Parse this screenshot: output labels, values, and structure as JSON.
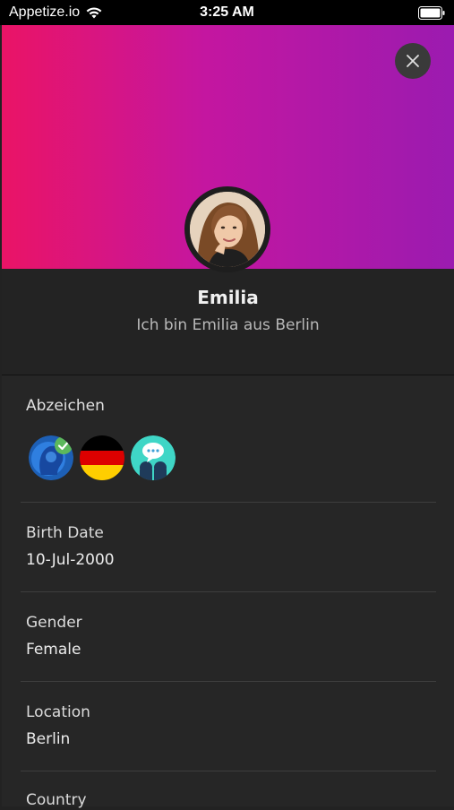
{
  "status_bar": {
    "carrier": "Appetize.io",
    "time": "3:25 AM"
  },
  "colors": {
    "gradient_start": "#ea1466",
    "gradient_end": "#9b1bb0",
    "background": "#262626"
  },
  "icons": {
    "close": "close-icon",
    "wifi": "wifi-icon",
    "battery": "battery-icon"
  },
  "profile": {
    "name": "Emilia",
    "bio": "Ich bin Emilia aus Berlin"
  },
  "badges": {
    "title": "Abzeichen",
    "items": [
      "verified-profile-badge",
      "germany-flag-badge",
      "chat-badge"
    ]
  },
  "details": [
    {
      "label": "Birth Date",
      "value": "10-Jul-2000"
    },
    {
      "label": "Gender",
      "value": "Female"
    },
    {
      "label": "Location",
      "value": "Berlin"
    },
    {
      "label": "Country",
      "value": ""
    }
  ]
}
